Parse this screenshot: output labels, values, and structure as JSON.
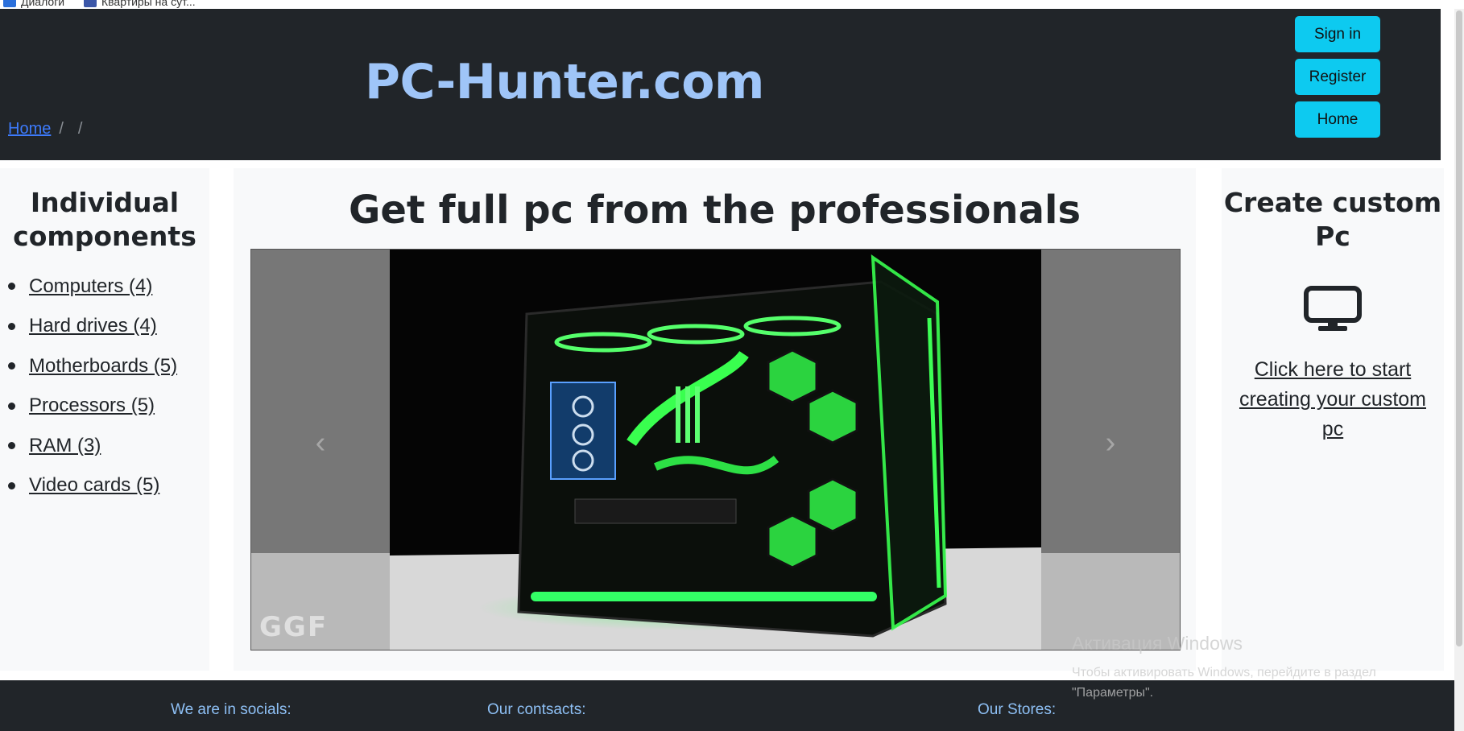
{
  "bookmarks": {
    "items": [
      "Диалоги",
      "Квартиры на сут..."
    ]
  },
  "header": {
    "brand": "PC-Hunter.com",
    "breadcrumb": {
      "home": "Home",
      "sep1": "/",
      "sep2": "/"
    },
    "buttons": {
      "sign_in": "Sign in",
      "register": "Register",
      "home": "Home"
    }
  },
  "left": {
    "title": "Individual components",
    "items": [
      "Computers (4)",
      "Hard drives (4)",
      "Motherboards (5)",
      "Processors (5)",
      "RAM (3)",
      "Video cards (5)"
    ]
  },
  "center": {
    "title": "Get full pc from the professionals",
    "carousel": {
      "prev_icon": "‹",
      "next_icon": "›",
      "watermark": "GGF"
    }
  },
  "right": {
    "title": "Create custom Pc",
    "icon": "monitor-icon",
    "link": "Click here to start creating your custom pc"
  },
  "footer": {
    "socials": "We are in socials:",
    "contacts": "Our contsacts:",
    "stores": "Our Stores:"
  },
  "windows": {
    "title": "Активация Windows",
    "text": "Чтобы активировать Windows, перейдите в раздел \"Параметры\"."
  },
  "colors": {
    "header_bg": "#212529",
    "brand": "#9fc5f8",
    "button": "#0dcaf0",
    "link": "#3d7bfd",
    "panel_bg": "#f8f9fa",
    "neon_green": "#2cff4a"
  }
}
